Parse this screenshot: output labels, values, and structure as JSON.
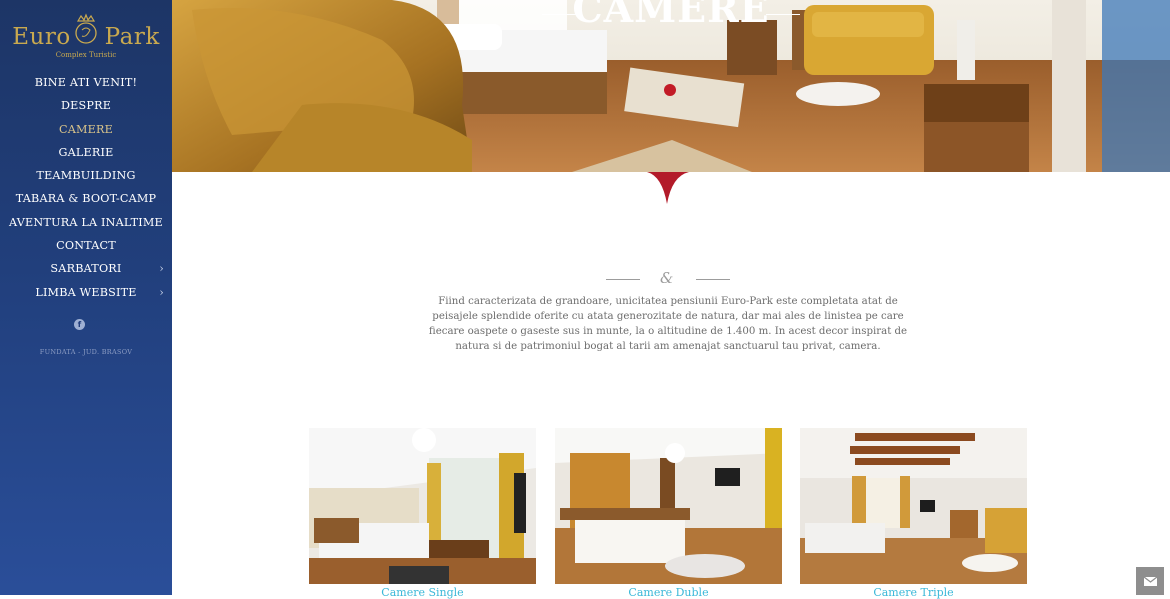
{
  "brand": {
    "name_left": "Euro",
    "name_right": "Park",
    "subtitle": "Complex Turistic",
    "gold": "#c9a94f"
  },
  "nav": {
    "items": [
      {
        "label": "BINE ATI VENIT!",
        "active": false,
        "submenu": false
      },
      {
        "label": "DESPRE",
        "active": false,
        "submenu": false
      },
      {
        "label": "CAMERE",
        "active": true,
        "submenu": false
      },
      {
        "label": "GALERIE",
        "active": false,
        "submenu": false
      },
      {
        "label": "TEAMBUILDING",
        "active": false,
        "submenu": false
      },
      {
        "label": "TABARA & BOOT-CAMP",
        "active": false,
        "submenu": false
      },
      {
        "label": "AVENTURA LA INALTIME",
        "active": false,
        "submenu": false
      },
      {
        "label": "CONTACT",
        "active": false,
        "submenu": false
      },
      {
        "label": "SARBATORI",
        "active": false,
        "submenu": true
      },
      {
        "label": "LIMBA WEBSITE",
        "active": false,
        "submenu": true
      }
    ],
    "submenu_icon": "chevron-right-icon"
  },
  "social": {
    "facebook_glyph": "f"
  },
  "address": "FUNDATA - JUD. BRASOV",
  "hero": {
    "title": "CAMERE"
  },
  "intro": {
    "ornament": "&",
    "text": "Fiind caracterizata de grandoare, unicitatea pensiunii Euro-Park este completata atat de peisajele splendide oferite cu atata generozitate de natura, dar mai ales de linistea pe care fiecare oaspete o gaseste sus in munte, la o altitudine de 1.400 m. In acest decor inspirat de natura si de patrimoniul bogat al tarii am amenajat sanctuarul tau privat, camera."
  },
  "rooms": [
    {
      "title": "Camere Single"
    },
    {
      "title": "Camere Duble"
    },
    {
      "title": "Camere Triple"
    }
  ],
  "colors": {
    "sidebar_top": "#1d3566",
    "sidebar_bottom": "#2a4e99",
    "link": "#3ab8d8",
    "accent_red": "#b31b2a",
    "active_nav": "#d9c48a"
  },
  "mail_button": {
    "icon": "envelope-icon"
  }
}
